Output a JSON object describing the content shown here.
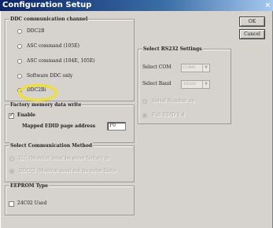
{
  "window": {
    "title": "Configuration Setup",
    "close_glyph": "×"
  },
  "buttons": {
    "ok": "OK",
    "cancel": "Cancel"
  },
  "ddc_channel": {
    "title": "DDC communication channel",
    "options": [
      {
        "label": "DDC2B",
        "selected": false
      },
      {
        "label": "ASC command (105E)",
        "selected": false
      },
      {
        "label": "ASC command (104E, 105E)",
        "selected": false
      },
      {
        "label": "Software DDC only",
        "selected": false
      },
      {
        "label": "DDC2Bi",
        "selected": true
      }
    ]
  },
  "factory_memory": {
    "title": "Factory memory data write",
    "enable_label": "Enable",
    "enable_checked": true,
    "mapped_label": "Mapped EDID page address",
    "mapped_value": "F0"
  },
  "comm_method": {
    "title": "Select Communication Method",
    "options": [
      {
        "label": "I2C   (Monitor must be enter factory m",
        "selected": false
      },
      {
        "label": "DDCCI (Monitor must not be enter facto",
        "selected": true
      }
    ]
  },
  "eeprom": {
    "title": "EEPROM Type",
    "option_label": "24C02 Used",
    "checked": false
  },
  "rs232": {
    "title": "Select RS232 Settings",
    "com_label": "Select COM",
    "com_value": "COM1",
    "baud_label": "Select Baud",
    "baud_value": "19200",
    "options": [
      {
        "label": "Serial Number on",
        "selected": false
      },
      {
        "label": "Full EDID 1.4",
        "selected": true
      }
    ]
  },
  "colors": {
    "title_start": "#0a246a",
    "title_end": "#a6caf0",
    "dialog_bg": "#d6d3ce",
    "highlight": "#f2e21a"
  }
}
